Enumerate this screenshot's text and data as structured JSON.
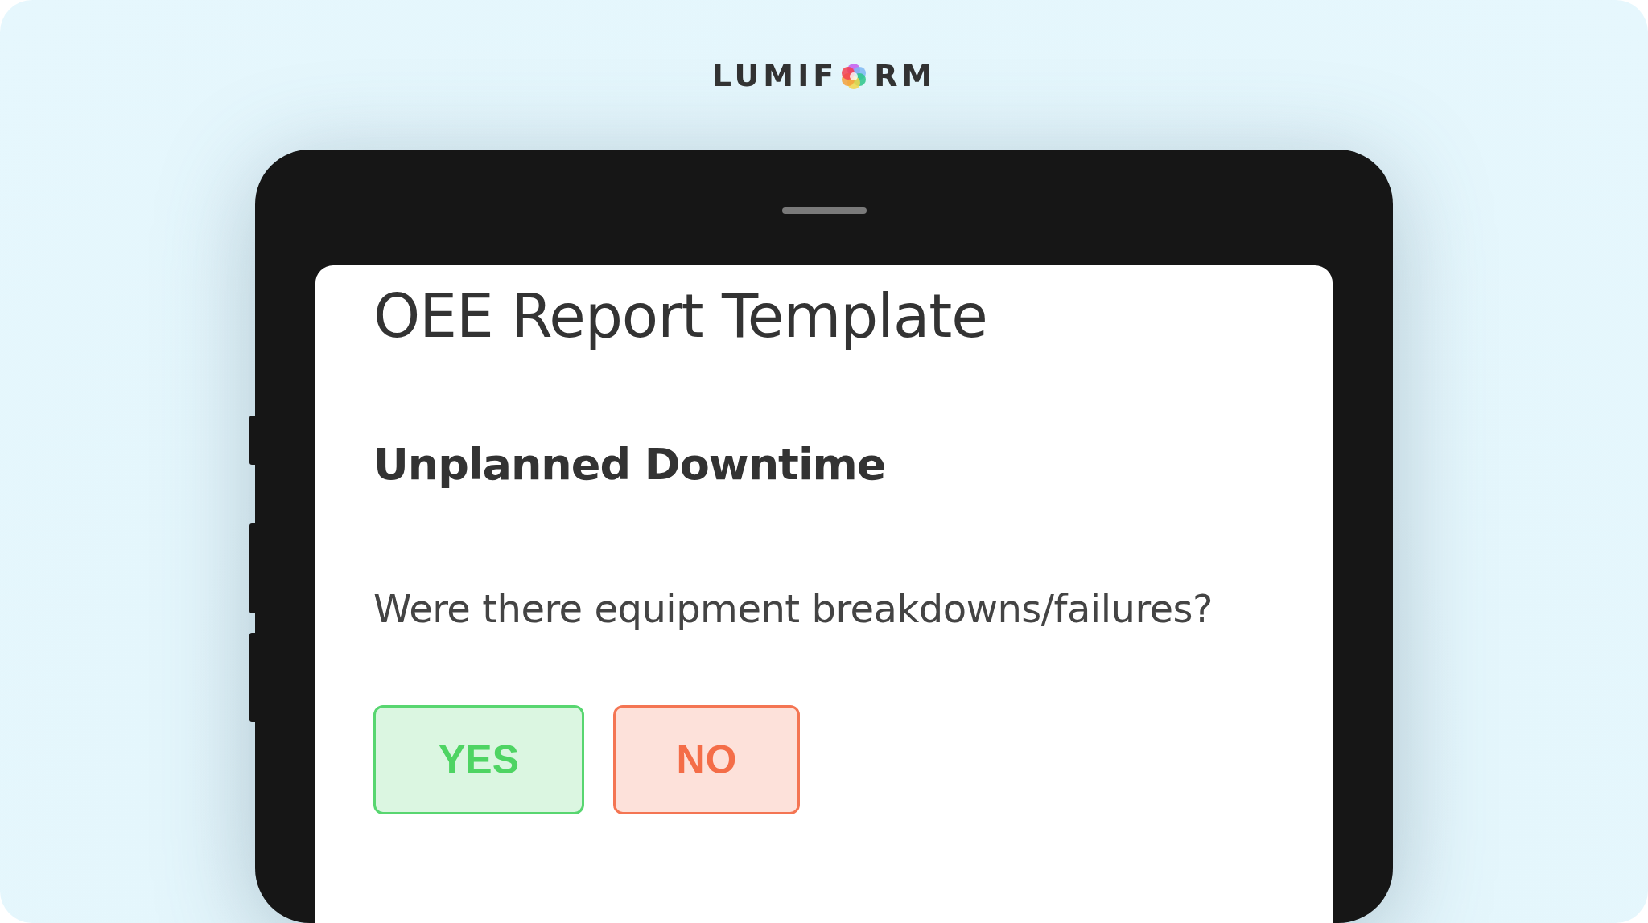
{
  "logo": {
    "before_icon": "LUMIF",
    "after_icon": "RM"
  },
  "form": {
    "title": "OEE Report Template",
    "section": "Unplanned Downtime",
    "question": "Were there equipment breakdowns/failures?",
    "answers": [
      {
        "label": "YES",
        "kind": "yes"
      },
      {
        "label": "NO",
        "kind": "no"
      }
    ]
  }
}
